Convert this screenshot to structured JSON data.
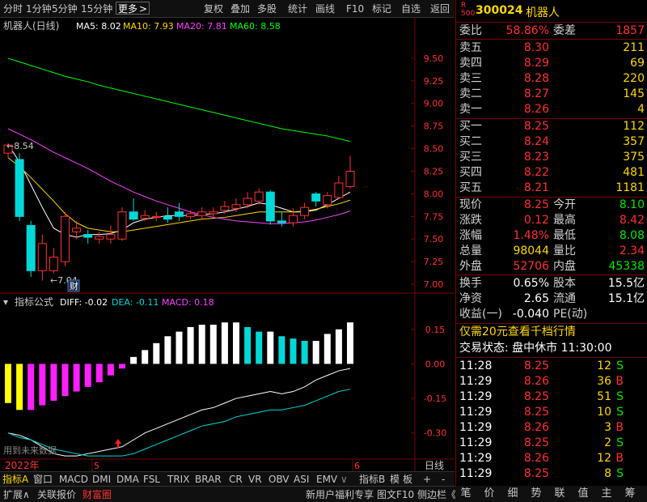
{
  "toolbar": {
    "items": [
      "分时",
      "1分钟",
      "5分钟",
      "15分钟",
      "更多",
      "复权",
      "叠加",
      "多股",
      "统计",
      "画线",
      "F10",
      "标记",
      "自选",
      "返回"
    ],
    "active_index": 4
  },
  "main_chart": {
    "title": "机器人(日线)",
    "ma": [
      {
        "label": "MA5: 8.02",
        "color": "#ffffff"
      },
      {
        "label": "MA10: 7.93",
        "color": "#ffd700"
      },
      {
        "label": "MA20: 7.81",
        "color": "#ff40ff"
      },
      {
        "label": "MA60: 8.58",
        "color": "#00ff00"
      }
    ],
    "price_axis": [
      "9.50",
      "9.25",
      "9.00",
      "8.75",
      "8.50",
      "8.25",
      "8.00",
      "7.75",
      "7.50",
      "7.25",
      "7.00"
    ],
    "high_label": "8.54",
    "low_label": "7.04",
    "cai_badge": "财"
  },
  "indicator": {
    "name": "指标公式",
    "diff_label": "DIFF: -0.02",
    "dea_label": "DEA: -0.11",
    "macd_label": "MACD: 0.18",
    "axis": [
      "0.15",
      "0.00",
      "-0.15",
      "-0.30"
    ],
    "future_note": "用到未来数据"
  },
  "date_axis": {
    "year": "2022年",
    "mid": "5",
    "end": "6",
    "period": "日线"
  },
  "chart_data": {
    "type": "candlestick",
    "ylim": [
      6.92,
      9.75
    ],
    "candles": [
      {
        "o": 8.45,
        "c": 8.54,
        "h": 8.56,
        "l": 8.4
      },
      {
        "o": 8.38,
        "c": 7.75,
        "h": 8.45,
        "l": 7.7
      },
      {
        "o": 7.65,
        "c": 7.15,
        "h": 7.7,
        "l": 7.08
      },
      {
        "o": 7.15,
        "c": 7.45,
        "h": 7.55,
        "l": 7.04
      },
      {
        "o": 7.15,
        "c": 7.3,
        "h": 7.4,
        "l": 7.12
      },
      {
        "o": 7.25,
        "c": 7.75,
        "h": 7.8,
        "l": 7.2
      },
      {
        "o": 7.58,
        "c": 7.62,
        "h": 7.7,
        "l": 7.5
      },
      {
        "o": 7.55,
        "c": 7.52,
        "h": 7.6,
        "l": 7.45
      },
      {
        "o": 7.5,
        "c": 7.53,
        "h": 7.58,
        "l": 7.45
      },
      {
        "o": 7.5,
        "c": 7.55,
        "h": 7.65,
        "l": 7.45
      },
      {
        "o": 7.5,
        "c": 7.8,
        "h": 7.85,
        "l": 7.48
      },
      {
        "o": 7.8,
        "c": 7.72,
        "h": 7.95,
        "l": 7.7
      },
      {
        "o": 7.73,
        "c": 7.76,
        "h": 7.82,
        "l": 7.7
      },
      {
        "o": 7.74,
        "c": 7.75,
        "h": 7.8,
        "l": 7.7
      },
      {
        "o": 7.75,
        "c": 7.72,
        "h": 7.85,
        "l": 7.68
      },
      {
        "o": 7.8,
        "c": 7.75,
        "h": 7.9,
        "l": 7.7
      },
      {
        "o": 7.75,
        "c": 7.78,
        "h": 7.82,
        "l": 7.72
      },
      {
        "o": 7.76,
        "c": 7.8,
        "h": 7.85,
        "l": 7.72
      },
      {
        "o": 7.78,
        "c": 7.8,
        "h": 7.85,
        "l": 7.74
      },
      {
        "o": 7.82,
        "c": 7.86,
        "h": 7.92,
        "l": 7.78
      },
      {
        "o": 7.84,
        "c": 7.88,
        "h": 7.95,
        "l": 7.8
      },
      {
        "o": 7.88,
        "c": 7.95,
        "h": 8.02,
        "l": 7.84
      },
      {
        "o": 7.92,
        "c": 8.02,
        "h": 8.06,
        "l": 7.88
      },
      {
        "o": 8.02,
        "c": 7.7,
        "h": 8.04,
        "l": 7.66
      },
      {
        "o": 7.7,
        "c": 7.68,
        "h": 7.8,
        "l": 7.64
      },
      {
        "o": 7.68,
        "c": 7.76,
        "h": 7.84,
        "l": 7.64
      },
      {
        "o": 7.76,
        "c": 7.85,
        "h": 7.9,
        "l": 7.72
      },
      {
        "o": 8.0,
        "c": 7.92,
        "h": 8.02,
        "l": 7.86
      },
      {
        "o": 7.88,
        "c": 7.98,
        "h": 8.02,
        "l": 7.84
      },
      {
        "o": 7.96,
        "c": 8.12,
        "h": 8.2,
        "l": 7.94
      },
      {
        "o": 8.08,
        "c": 8.25,
        "h": 8.42,
        "l": 8.06
      }
    ],
    "ma5": [
      8.55,
      8.35,
      8.1,
      7.85,
      7.62,
      7.55,
      7.52,
      7.55,
      7.55,
      7.56,
      7.6,
      7.68,
      7.72,
      7.74,
      7.76,
      7.76,
      7.76,
      7.77,
      7.78,
      7.8,
      7.83,
      7.86,
      7.9,
      7.88,
      7.84,
      7.8,
      7.8,
      7.82,
      7.88,
      7.95,
      8.02
    ],
    "ma10": [
      8.4,
      8.3,
      8.18,
      8.05,
      7.92,
      7.78,
      7.68,
      7.62,
      7.6,
      7.58,
      7.58,
      7.6,
      7.62,
      7.64,
      7.66,
      7.68,
      7.7,
      7.72,
      7.73,
      7.74,
      7.76,
      7.78,
      7.8,
      7.8,
      7.8,
      7.8,
      7.81,
      7.83,
      7.86,
      7.89,
      7.93
    ],
    "ma20": [
      8.72,
      8.66,
      8.6,
      8.53,
      8.46,
      8.4,
      8.34,
      8.28,
      8.21,
      8.14,
      8.08,
      8.02,
      7.97,
      7.92,
      7.88,
      7.84,
      7.8,
      7.77,
      7.74,
      7.72,
      7.7,
      7.69,
      7.68,
      7.67,
      7.67,
      7.68,
      7.69,
      7.71,
      7.74,
      7.77,
      7.81
    ],
    "ma60": [
      9.5,
      9.46,
      9.42,
      9.38,
      9.34,
      9.3,
      9.27,
      9.24,
      9.2,
      9.17,
      9.14,
      9.11,
      9.08,
      9.05,
      9.02,
      8.99,
      8.96,
      8.93,
      8.9,
      8.87,
      8.84,
      8.81,
      8.78,
      8.75,
      8.72,
      8.7,
      8.68,
      8.66,
      8.64,
      8.61,
      8.58
    ],
    "macd_ylim": [
      -0.41,
      0.23
    ],
    "macd": [
      -0.17,
      -0.2,
      -0.2,
      -0.18,
      -0.16,
      -0.14,
      -0.12,
      -0.1,
      -0.08,
      -0.05,
      -0.02,
      0.03,
      0.06,
      0.09,
      0.12,
      0.14,
      0.16,
      0.17,
      0.17,
      0.18,
      0.18,
      0.16,
      0.14,
      0.14,
      0.12,
      0.11,
      0.1,
      0.1,
      0.13,
      0.15,
      0.18
    ],
    "diff": [
      -0.3,
      -0.31,
      -0.33,
      -0.36,
      -0.39,
      -0.4,
      -0.4,
      -0.39,
      -0.38,
      -0.37,
      -0.36,
      -0.33,
      -0.3,
      -0.28,
      -0.26,
      -0.24,
      -0.22,
      -0.2,
      -0.19,
      -0.17,
      -0.15,
      -0.14,
      -0.13,
      -0.12,
      -0.13,
      -0.12,
      -0.1,
      -0.07,
      -0.05,
      -0.03,
      -0.02
    ],
    "dea": [
      -0.3,
      -0.32,
      -0.33,
      -0.35,
      -0.37,
      -0.38,
      -0.39,
      -0.4,
      -0.4,
      -0.4,
      -0.4,
      -0.39,
      -0.37,
      -0.35,
      -0.33,
      -0.31,
      -0.29,
      -0.27,
      -0.26,
      -0.25,
      -0.23,
      -0.22,
      -0.21,
      -0.2,
      -0.2,
      -0.19,
      -0.18,
      -0.16,
      -0.14,
      -0.12,
      -0.11
    ]
  },
  "quote": {
    "code": "300024",
    "name": "机器人",
    "webi_label": "委比",
    "webi_value": "58.86%",
    "weicha_label": "委差",
    "weicha_value": "1857",
    "sells": [
      {
        "label": "卖五",
        "price": "8.30",
        "vol": "211"
      },
      {
        "label": "卖四",
        "price": "8.29",
        "vol": "69"
      },
      {
        "label": "卖三",
        "price": "8.28",
        "vol": "220"
      },
      {
        "label": "卖二",
        "price": "8.27",
        "vol": "145"
      },
      {
        "label": "卖一",
        "price": "8.26",
        "vol": "4"
      }
    ],
    "buys": [
      {
        "label": "买一",
        "price": "8.25",
        "vol": "112"
      },
      {
        "label": "买二",
        "price": "8.24",
        "vol": "357"
      },
      {
        "label": "买三",
        "price": "8.23",
        "vol": "375"
      },
      {
        "label": "买四",
        "price": "8.22",
        "vol": "481"
      },
      {
        "label": "买五",
        "price": "8.21",
        "vol": "1181"
      }
    ],
    "stats": [
      {
        "l1": "现价",
        "v1": "8.25",
        "c1": "red",
        "l2": "今开",
        "v2": "8.10",
        "c2": "green"
      },
      {
        "l1": "涨跌",
        "v1": "0.12",
        "c1": "red",
        "l2": "最高",
        "v2": "8.42",
        "c2": "red"
      },
      {
        "l1": "涨幅",
        "v1": "1.48%",
        "c1": "red",
        "l2": "最低",
        "v2": "8.08",
        "c2": "green"
      },
      {
        "l1": "总量",
        "v1": "98044",
        "c1": "yellow",
        "l2": "量比",
        "v2": "2.34",
        "c2": "red"
      },
      {
        "l1": "外盘",
        "v1": "52706",
        "c1": "red",
        "l2": "内盘",
        "v2": "45338",
        "c2": "green"
      }
    ],
    "stats2": [
      {
        "l1": "换手",
        "v1": "0.65%",
        "l2": "股本",
        "v2": "15.5亿"
      },
      {
        "l1": "净资",
        "v1": "2.65",
        "l2": "流通",
        "v2": "15.1亿"
      },
      {
        "l1": "收益(一)",
        "v1": "-0.040",
        "l2": "PE(动)",
        "v2": ""
      }
    ],
    "promo": "仅需20元查看千档行情",
    "trade_status": "交易状态: 盘中休市 11:30:00",
    "ticks": [
      {
        "t": "11:28",
        "p": "8.25",
        "v": "12",
        "s": "S"
      },
      {
        "t": "11:29",
        "p": "8.26",
        "v": "36",
        "s": "B"
      },
      {
        "t": "11:29",
        "p": "8.25",
        "v": "51",
        "s": "S"
      },
      {
        "t": "11:29",
        "p": "8.25",
        "v": "10",
        "s": "S"
      },
      {
        "t": "11:29",
        "p": "8.26",
        "v": "3",
        "s": "B"
      },
      {
        "t": "11:29",
        "p": "8.25",
        "v": "2",
        "s": "S"
      },
      {
        "t": "11:29",
        "p": "8.26",
        "v": "12",
        "s": "B"
      },
      {
        "t": "11:29",
        "p": "8.25",
        "v": "8",
        "s": "S"
      }
    ]
  },
  "indicator_tabs": [
    "指标A",
    "窗口",
    "MACD",
    "DMI",
    "DMA",
    "FSL",
    "TRIX",
    "BRAR",
    "CR",
    "VR",
    "OBV",
    "ASI",
    "EMV",
    "指标B",
    "模",
    "板"
  ],
  "status_bar": {
    "items": [
      "扩展∧",
      "关联报价",
      "财富圈",
      "新用户福利专享",
      "图文F10",
      "侧边栏《"
    ]
  },
  "right_tabs": [
    "笔",
    "价",
    "细",
    "势",
    "联",
    "值",
    "主",
    "筹"
  ]
}
